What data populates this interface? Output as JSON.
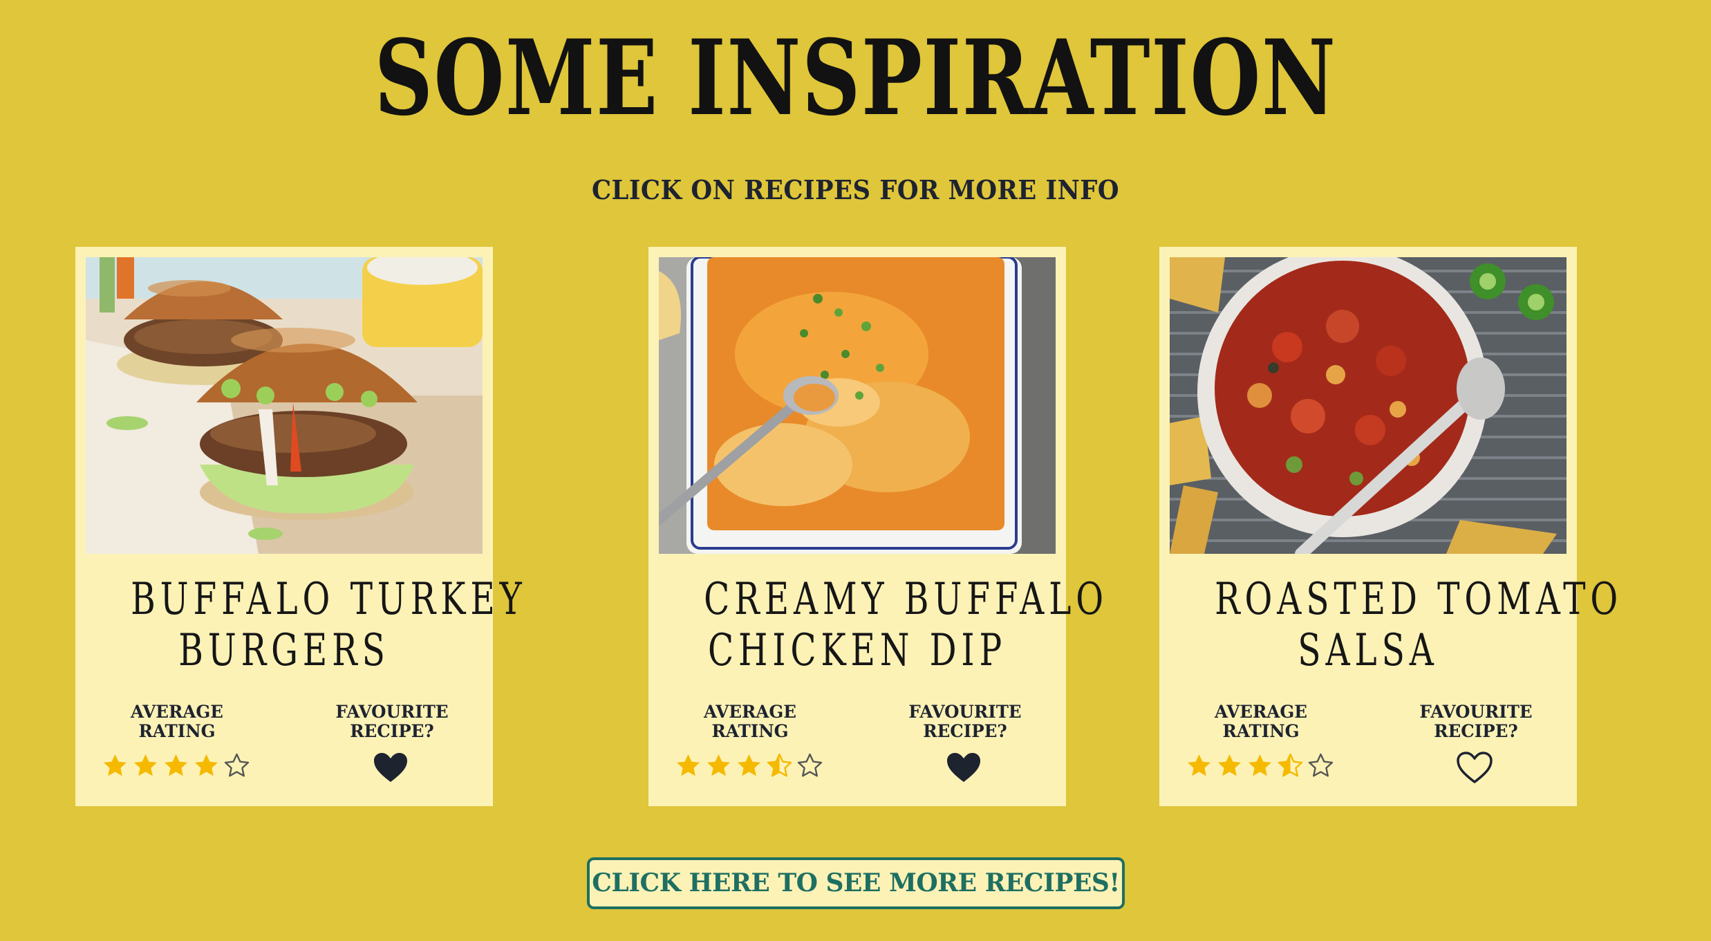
{
  "header": {
    "title": "SOME INSPIRATION",
    "subtitle": "CLICK ON RECIPES FOR MORE INFO"
  },
  "recipes": [
    {
      "title_line1": "BUFFALO TURKEY",
      "title_line2": "BURGERS",
      "rating_label_line1": "AVERAGE",
      "rating_label_line2": "RATING",
      "favourite_label_line1": "FAVOURITE",
      "favourite_label_line2": "RECIPE?",
      "rating": 4,
      "favourite": true
    },
    {
      "title_line1": "CREAMY BUFFALO",
      "title_line2": "CHICKEN DIP",
      "rating_label_line1": "AVERAGE",
      "rating_label_line2": "RATING",
      "favourite_label_line1": "FAVOURITE",
      "favourite_label_line2": "RECIPE?",
      "rating": 3.5,
      "favourite": true
    },
    {
      "title_line1": "ROASTED TOMATO",
      "title_line2": "SALSA",
      "rating_label_line1": "AVERAGE",
      "rating_label_line2": "RATING",
      "favourite_label_line1": "FAVOURITE",
      "favourite_label_line2": "RECIPE?",
      "rating": 3.5,
      "favourite": false
    }
  ],
  "more_button": {
    "label": "CLICK HERE TO SEE MORE RECIPES!"
  },
  "colors": {
    "background": "#dfc63a",
    "card": "#fcf2b6",
    "star": "#f5b900",
    "heart": "#1e2330",
    "button_accent": "#1e6f62"
  }
}
